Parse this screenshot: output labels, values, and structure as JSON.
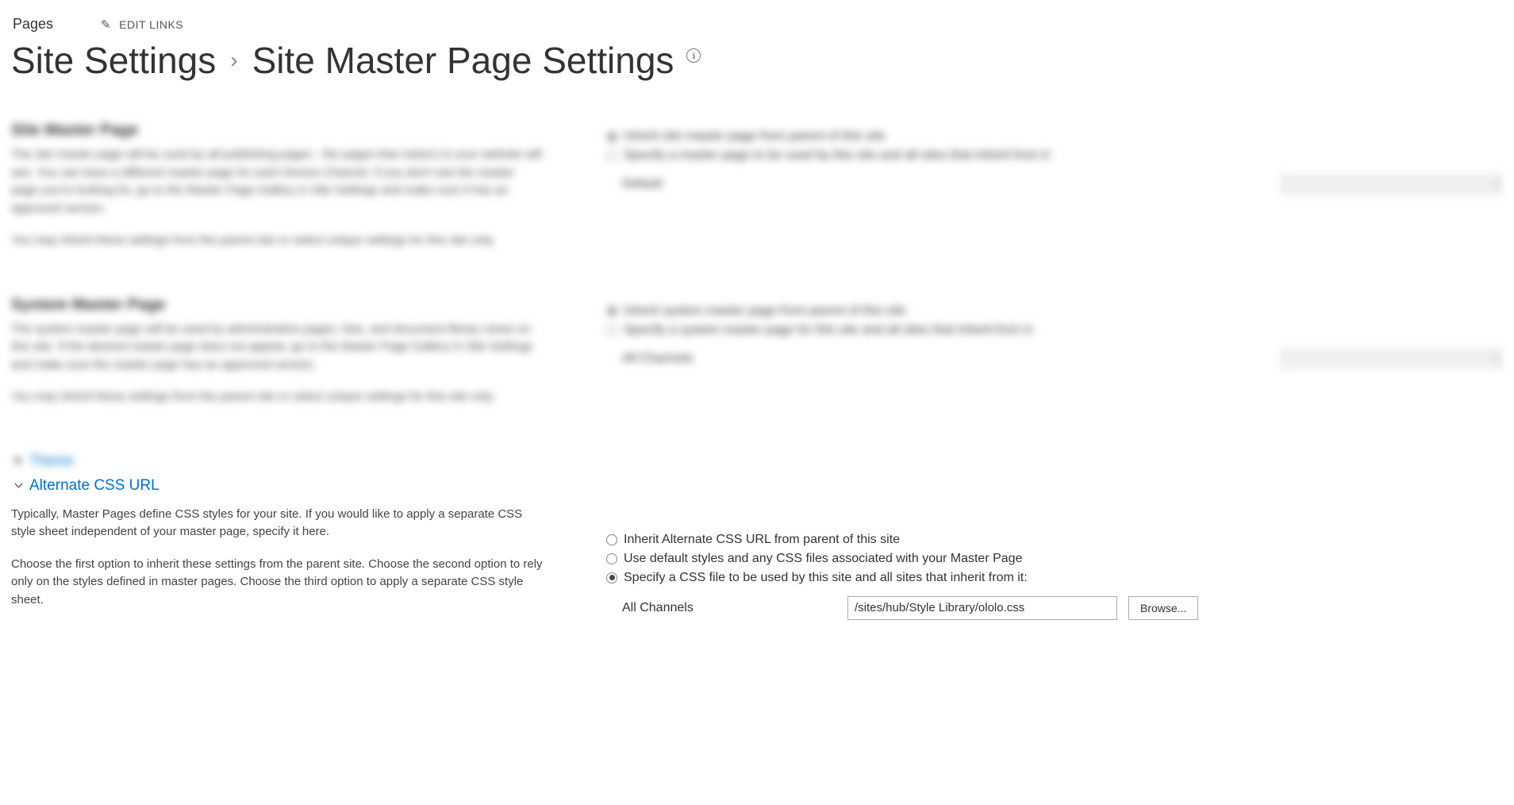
{
  "topbar": {
    "pages_label": "Pages",
    "edit_links_label": "EDIT LINKS"
  },
  "title": {
    "breadcrumb_root": "Site Settings",
    "current": "Site Master Page Settings"
  },
  "section_site_master": {
    "heading": "Site Master Page",
    "desc1": "The site master page will be used by all publishing pages - the pages that visitors to your website will see. You can have a different master page for each Device Channel. If you don't see the master page you're looking for, go to the Master Page Gallery in Site Settings and make sure it has an approved version.",
    "desc2": "You may inherit these settings from the parent site or select unique settings for this site only.",
    "radio_inherit": "Inherit site master page from parent of this site",
    "radio_specify": "Specify a master page to be used by this site and all sites that inherit from it:",
    "channel_label": "Default"
  },
  "section_system_master": {
    "heading": "System Master Page",
    "desc1": "The system master page will be used by administrative pages, lists, and document library views on this site. If the desired master page does not appear, go to the Master Page Gallery in Site Settings and make sure the master page has an approved version.",
    "desc2": "You may inherit these settings from the parent site or select unique settings for this site only.",
    "radio_inherit": "Inherit system master page from parent of this site",
    "radio_specify": "Specify a system master page for this site and all sites that inherit from it:",
    "channel_label": "All Channels"
  },
  "theme_link": "Theme",
  "section_alt_css": {
    "heading": "Alternate CSS URL",
    "desc1": "Typically, Master Pages define CSS styles for your site. If you would like to apply a separate CSS style sheet independent of your master page, specify it here.",
    "desc2": "Choose the first option to inherit these settings from the parent site. Choose the second option to rely only on the styles defined in master pages. Choose the third option to apply a separate CSS style sheet.",
    "radio_inherit": "Inherit Alternate CSS URL from parent of this site",
    "radio_default": "Use default styles and any CSS files associated with your Master Page",
    "radio_specify": "Specify a CSS file to be used by this site and all sites that inherit from it:",
    "channel_label": "All Channels",
    "input_value": "/sites/hub/Style Library/ololo.css",
    "browse_label": "Browse..."
  }
}
